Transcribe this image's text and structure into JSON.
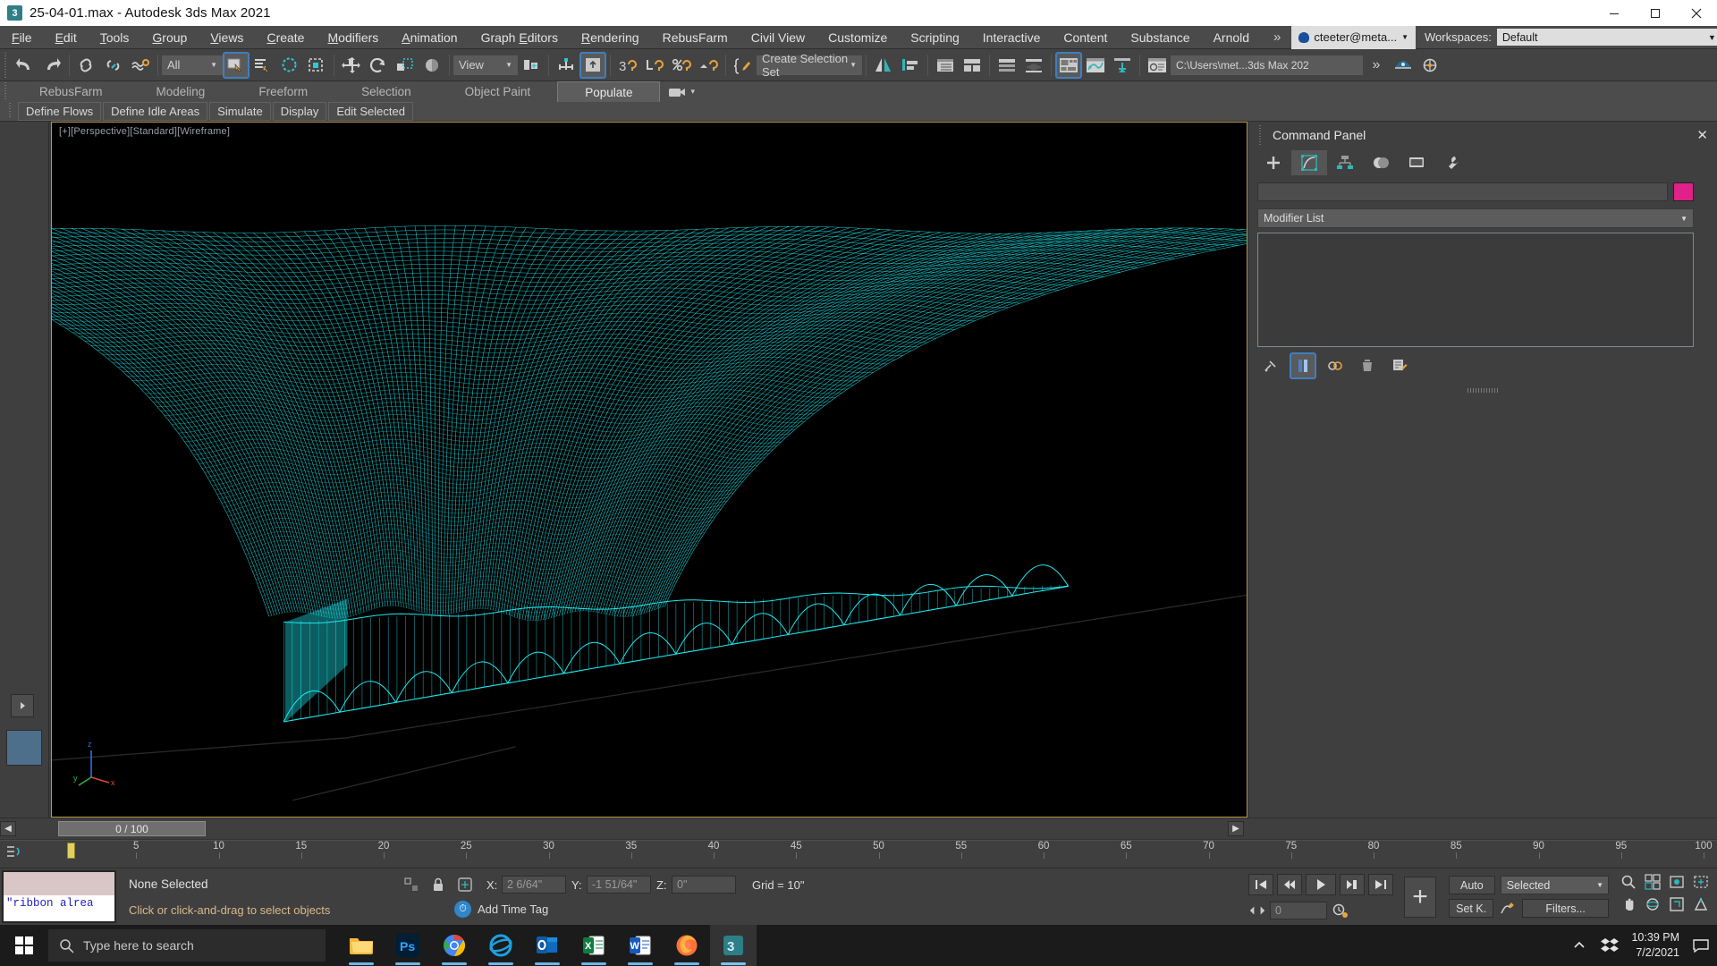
{
  "titlebar": {
    "icon": "3dsmax-icon",
    "title": "25-04-01.max - Autodesk 3ds Max 2021",
    "minimize": "minimize-icon",
    "maximize": "maximize-icon",
    "close": "close-icon"
  },
  "menubar": {
    "items": [
      {
        "label": "File",
        "mnemonic": "F"
      },
      {
        "label": "Edit",
        "mnemonic": "E"
      },
      {
        "label": "Tools",
        "mnemonic": "T"
      },
      {
        "label": "Group",
        "mnemonic": "G"
      },
      {
        "label": "Views",
        "mnemonic": "V"
      },
      {
        "label": "Create",
        "mnemonic": "C"
      },
      {
        "label": "Modifiers",
        "mnemonic": "M"
      },
      {
        "label": "Animation",
        "mnemonic": "A"
      },
      {
        "label": "Graph Editors",
        "mnemonic": "E"
      },
      {
        "label": "Rendering",
        "mnemonic": "R"
      },
      {
        "label": "RebusFarm",
        "mnemonic": ""
      },
      {
        "label": "Civil View",
        "mnemonic": ""
      },
      {
        "label": "Customize",
        "mnemonic": ""
      },
      {
        "label": "Scripting",
        "mnemonic": ""
      },
      {
        "label": "Interactive",
        "mnemonic": ""
      },
      {
        "label": "Content",
        "mnemonic": ""
      },
      {
        "label": "Substance",
        "mnemonic": ""
      },
      {
        "label": "Arnold",
        "mnemonic": ""
      }
    ],
    "overflow": "»",
    "account": "cteeter@meta...",
    "workspaces_label": "Workspaces:",
    "workspace_value": "Default"
  },
  "toolbar": {
    "selection_filter": "All",
    "reference_coord": "View",
    "selection_set": "Create Selection Set",
    "project_path": "C:\\Users\\met...3ds Max 202",
    "overflow": "»",
    "buttons": [
      "undo-icon",
      "redo-icon",
      "select-link-icon",
      "unlink-icon",
      "bind-space-warp-icon",
      "select-object-icon",
      "select-by-name-icon",
      "select-region-circle-icon",
      "window-crossing-icon",
      "select-move-icon",
      "select-rotate-icon",
      "select-scale-icon",
      "placement-icon",
      "mirror-icon",
      "align-icon",
      "snap-toggle-icon",
      "angle-snap-icon",
      "percent-snap-icon",
      "spinner-snap-icon",
      "named-selection-icon",
      "material-editor-icon",
      "render-setup-icon",
      "rendered-frame-icon",
      "render-production-icon",
      "scene-explorer-icon",
      "layer-explorer-icon",
      "ribbon-toggle-icon",
      "curve-editor-icon",
      "schematic-view-icon",
      "content-browser-icon"
    ]
  },
  "ribbon": {
    "tabs": [
      {
        "label": "RebusFarm",
        "active": false
      },
      {
        "label": "Modeling",
        "active": false
      },
      {
        "label": "Freeform",
        "active": false
      },
      {
        "label": "Selection",
        "active": false
      },
      {
        "label": "Object Paint",
        "active": false
      },
      {
        "label": "Populate",
        "active": true
      }
    ],
    "camera_icon": "camera-icon",
    "camera_arrow": "▾",
    "subtabs": [
      {
        "label": "Define Flows"
      },
      {
        "label": "Define Idle Areas"
      },
      {
        "label": "Simulate"
      },
      {
        "label": "Display"
      },
      {
        "label": "Edit Selected"
      }
    ]
  },
  "viewport": {
    "label": "[+][Perspective][Standard][Wireframe]",
    "wireframe_color": "#1de9f0",
    "background_color": "#000000",
    "border_color": "#b89b4a",
    "axis_labels": {
      "z": "z",
      "y": "y",
      "x": "x"
    }
  },
  "command_panel": {
    "title": "Command Panel",
    "close": "close-icon",
    "tabs": [
      {
        "name": "create-tab",
        "icon": "plus-icon",
        "active": false
      },
      {
        "name": "modify-tab",
        "icon": "modify-icon",
        "active": true
      },
      {
        "name": "hierarchy-tab",
        "icon": "hierarchy-icon",
        "active": false
      },
      {
        "name": "motion-tab",
        "icon": "motion-icon",
        "active": false
      },
      {
        "name": "display-tab",
        "icon": "display-icon",
        "active": false
      },
      {
        "name": "utilities-tab",
        "icon": "wrench-icon",
        "active": false
      }
    ],
    "object_name": "",
    "object_color": "#e0218a",
    "modifier_list": "Modifier List",
    "modifier_list_arrow": "▾",
    "stack_buttons": [
      "pin-stack-icon",
      "show-end-result-icon",
      "make-unique-icon",
      "remove-modifier-icon",
      "configure-sets-icon"
    ]
  },
  "time_slider": {
    "prev": "◀",
    "next": "▶",
    "value": "0 / 100"
  },
  "track_bar": {
    "filter_icon": "track-filter-icon",
    "ticks": [
      5,
      10,
      15,
      20,
      25,
      30,
      35,
      40,
      45,
      50,
      55,
      60,
      65,
      70,
      75,
      80,
      85,
      90,
      95,
      100
    ]
  },
  "status_bar": {
    "listener_text": "\"ribbon alrea",
    "selection_status": "None Selected",
    "prompt": "Click or click-and-drag to select objects",
    "isolate_icon": "isolate-selection-icon",
    "lock_icon": "lock-selection-icon",
    "absolute_icon": "absolute-mode-icon",
    "coords": [
      {
        "axis": "X:",
        "value": "2 6/64\""
      },
      {
        "axis": "Y:",
        "value": "-1 51/64\""
      },
      {
        "axis": "Z:",
        "value": "0\""
      }
    ],
    "grid": "Grid = 10\"",
    "add_time_tag": "Add Time Tag",
    "add_time_icon": "time-tag-icon",
    "playback": [
      "go-to-start-icon",
      "previous-frame-icon",
      "play-icon",
      "next-frame-icon",
      "go-to-end-icon"
    ],
    "key_frame_value": "0",
    "key_mode_icon": "key-mode-icon",
    "set_key": "Set K.",
    "auto_key": "Auto",
    "key_filters": "Filters...",
    "key_selected": "Selected",
    "big_plus": "+",
    "nav_icons": [
      "zoom-icon",
      "zoom-all-icon",
      "zoom-extents-icon",
      "zoom-region-icon",
      "pan-icon",
      "orbit-icon",
      "maximize-viewport-icon",
      "field-of-view-icon"
    ]
  },
  "taskbar": {
    "start": "windows-start-icon",
    "search_placeholder": "Type here to search",
    "search_icon": "search-icon",
    "apps": [
      {
        "name": "file-explorer-icon",
        "running": true,
        "active": false
      },
      {
        "name": "photoshop-icon",
        "running": true,
        "active": false
      },
      {
        "name": "chrome-icon",
        "running": true,
        "active": false
      },
      {
        "name": "internet-explorer-icon",
        "running": true,
        "active": false
      },
      {
        "name": "outlook-icon",
        "running": true,
        "active": false
      },
      {
        "name": "excel-icon",
        "running": true,
        "active": false
      },
      {
        "name": "word-icon",
        "running": true,
        "active": false
      },
      {
        "name": "firefox-icon",
        "running": true,
        "active": false
      },
      {
        "name": "3dsmax-icon",
        "running": true,
        "active": true
      }
    ],
    "tray": {
      "chevron": "show-hidden-icons-icon",
      "dropbox": "dropbox-icon",
      "time": "10:39 PM",
      "date": "7/2/2021",
      "notifications": "action-center-icon"
    }
  }
}
